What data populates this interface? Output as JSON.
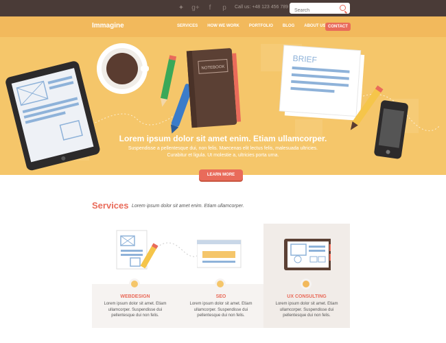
{
  "topbar": {
    "social_icons": [
      "twitter-icon",
      "google-plus-icon",
      "facebook-icon",
      "pinterest-icon"
    ],
    "call_us": "Call us: +48 123 456 789",
    "search": {
      "placeholder": "Search"
    }
  },
  "nav": {
    "logo": "Immagine",
    "items": [
      "SERVICES",
      "HOW WE WORK",
      "PORTFOLIO",
      "BLOG",
      "ABOUT US"
    ],
    "contact": "CONTACT"
  },
  "hero": {
    "title": "Lorem ipsum dolor sit amet enim. Etiam ullamcorper.",
    "subtitle": "Suspendisse a pellentesque dui, non felis. Maecenas elit lectus felis, malesuada ultricies. Curabitur et ligula. Ut molestie a, ultricies porta urna.",
    "button": "LEARN MORE",
    "notebook_label": "NOTEBOOK",
    "brief_label": "BRIEF"
  },
  "services": {
    "heading": "Services",
    "tagline": "Lorem ipsum dolor sit amet enim. Etiam ullamcorper.",
    "items": [
      {
        "name": "WEBDESIGN",
        "desc": "Lorem ipsum dolor sit amet. Etiam ullamcorper. Suspendisse dui pellentesque dui non felis."
      },
      {
        "name": "SEO",
        "desc": "Lorem ipsum dolor sit amet. Etiam ullamcorper. Suspendisse dui pellentesque dui non felis."
      },
      {
        "name": "UX CONSULTING",
        "desc": "Lorem ipsum dolor sit amet. Etiam ullamcorper. Suspendisse dui pellentesque dui non felis."
      }
    ]
  },
  "colors": {
    "accent": "#e96b5a",
    "hero": "#f5c66a",
    "topbar": "#4a3b37"
  }
}
